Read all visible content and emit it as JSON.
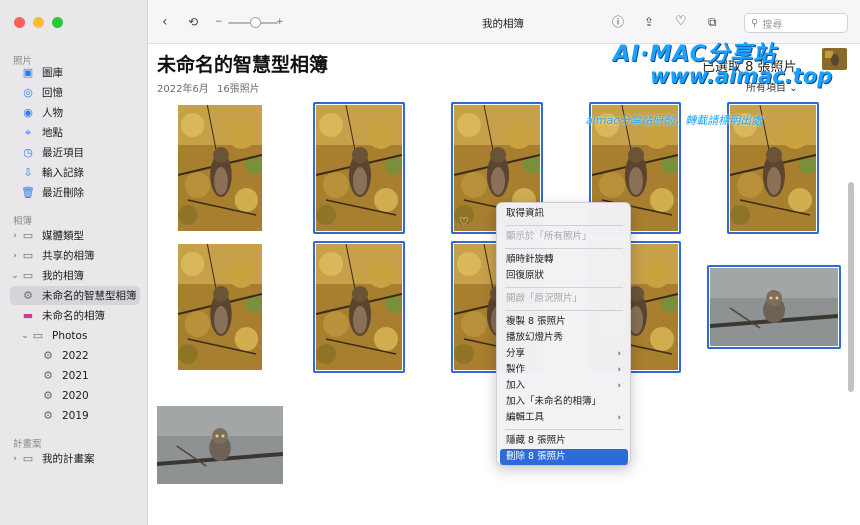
{
  "sidebar": {
    "section_photos": "照片",
    "photos_items": [
      {
        "label": "圖庫",
        "icon": "library-icon"
      },
      {
        "label": "回憶",
        "icon": "memories-icon"
      },
      {
        "label": "人物",
        "icon": "people-icon"
      },
      {
        "label": "地點",
        "icon": "places-icon"
      },
      {
        "label": "最近項目",
        "icon": "recents-icon"
      },
      {
        "label": "輸入記錄",
        "icon": "imports-icon"
      },
      {
        "label": "最近刪除",
        "icon": "trash-icon"
      }
    ],
    "section_albums": "相簿",
    "album_items": [
      {
        "label": "媒體類型",
        "icon": "folder-icon"
      },
      {
        "label": "共享的相簿",
        "icon": "shared-album-icon"
      },
      {
        "label": "我的相簿",
        "icon": "folder-icon"
      },
      {
        "label": "未命名的智慧型相簿",
        "icon": "smart-album-icon"
      },
      {
        "label": "未命名的相簿",
        "icon": "album-icon"
      },
      {
        "label": "Photos",
        "icon": "folder-icon"
      },
      {
        "label": "2022",
        "icon": "smart-album-icon"
      },
      {
        "label": "2021",
        "icon": "smart-album-icon"
      },
      {
        "label": "2020",
        "icon": "smart-album-icon"
      },
      {
        "label": "2019",
        "icon": "smart-album-icon"
      }
    ],
    "section_projects": "計畫案",
    "project_items": [
      {
        "label": "我的計畫案",
        "icon": "folder-icon"
      }
    ]
  },
  "toolbar": {
    "title": "我的相簿",
    "zoom_minus": "−",
    "zoom_plus": "+",
    "search_placeholder": "搜尋"
  },
  "header": {
    "album_title": "未命名的智慧型相簿",
    "date": "2022年6月",
    "photo_count": "16張照片",
    "selected_count": "已選取 8 張照片",
    "filter_label": "所有項目"
  },
  "watermark": {
    "line1": "AI·MAC分享站",
    "line2": "www.aimac.top",
    "line3": "aimac分享站原創，轉載請標明出處"
  },
  "context_menu": {
    "items": [
      {
        "label": "取得資訊",
        "state": "normal"
      },
      {
        "label": "顯示於「所有照片」",
        "state": "disabled"
      },
      {
        "label": "順時針旋轉",
        "state": "normal"
      },
      {
        "label": "回復原狀",
        "state": "normal"
      },
      {
        "label": "開啟「原況照片」",
        "state": "disabled"
      },
      {
        "label": "複製 8 張照片",
        "state": "normal"
      },
      {
        "label": "播放幻燈片秀",
        "state": "normal"
      },
      {
        "label": "分享",
        "state": "submenu"
      },
      {
        "label": "製作",
        "state": "submenu"
      },
      {
        "label": "加入",
        "state": "submenu"
      },
      {
        "label": "加入「未命名的相簿」",
        "state": "normal"
      },
      {
        "label": "編輯工具",
        "state": "submenu"
      },
      {
        "label": "隱藏 8 張照片",
        "state": "normal"
      },
      {
        "label": "刪除 8 張照片",
        "state": "active"
      }
    ],
    "submenu_arrow": "›"
  },
  "grid": {
    "photos": [
      {
        "kind": "owl-autumn",
        "selected": false
      },
      {
        "kind": "owl-autumn",
        "selected": true
      },
      {
        "kind": "owl-autumn",
        "selected": true
      },
      {
        "kind": "owl-autumn",
        "selected": true
      },
      {
        "kind": "owl-autumn",
        "selected": true
      },
      {
        "kind": "owl-autumn",
        "selected": false
      },
      {
        "kind": "owl-autumn",
        "selected": true
      },
      {
        "kind": "owl-autumn",
        "selected": true
      },
      {
        "kind": "owl-autumn",
        "selected": true
      },
      {
        "kind": "owlet-branch",
        "selected": true
      },
      {
        "kind": "owlet-branch",
        "selected": false
      }
    ]
  },
  "colors": {
    "accent": "#2f6bd8",
    "sidebar_icon": "#2b7cf6",
    "watermark": "#1da1ff"
  }
}
